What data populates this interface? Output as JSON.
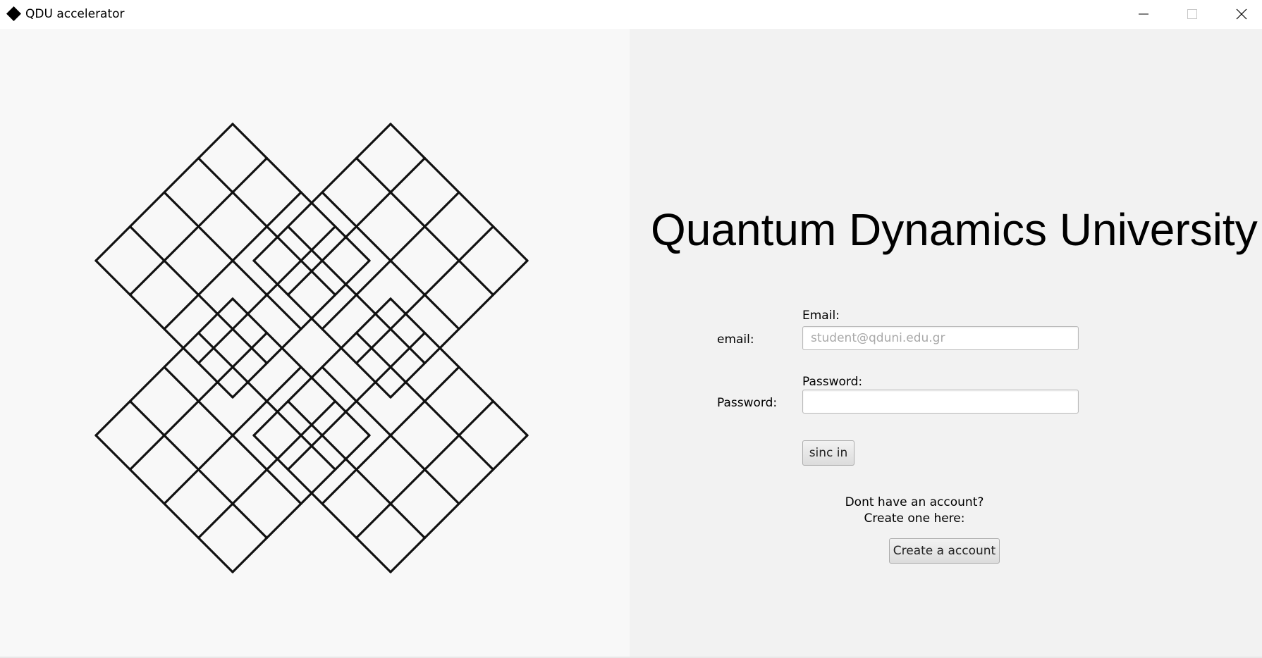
{
  "window": {
    "title": "QDU accelerator",
    "icon": "diamond-icon",
    "controls": [
      "minimize-icon",
      "maximize-icon",
      "close-icon"
    ]
  },
  "login": {
    "heading": "Quantum Dynamics University",
    "email_row_label": "email:",
    "email_field_label": "Email:",
    "email_value": "",
    "email_placeholder": "student@qduni.edu.gr",
    "password_row_label": "Password:",
    "password_field_label": "Password:",
    "password_value": "",
    "signin_label": "sinc in",
    "no_account_line1": "Dont have an account?",
    "no_account_line2": "Create one here:",
    "create_account_label": "Create a account"
  },
  "colors": {
    "left_panel_bg": "#f8f8f8",
    "right_panel_bg": "#f2f2f2",
    "logo_stroke": "#111111"
  }
}
